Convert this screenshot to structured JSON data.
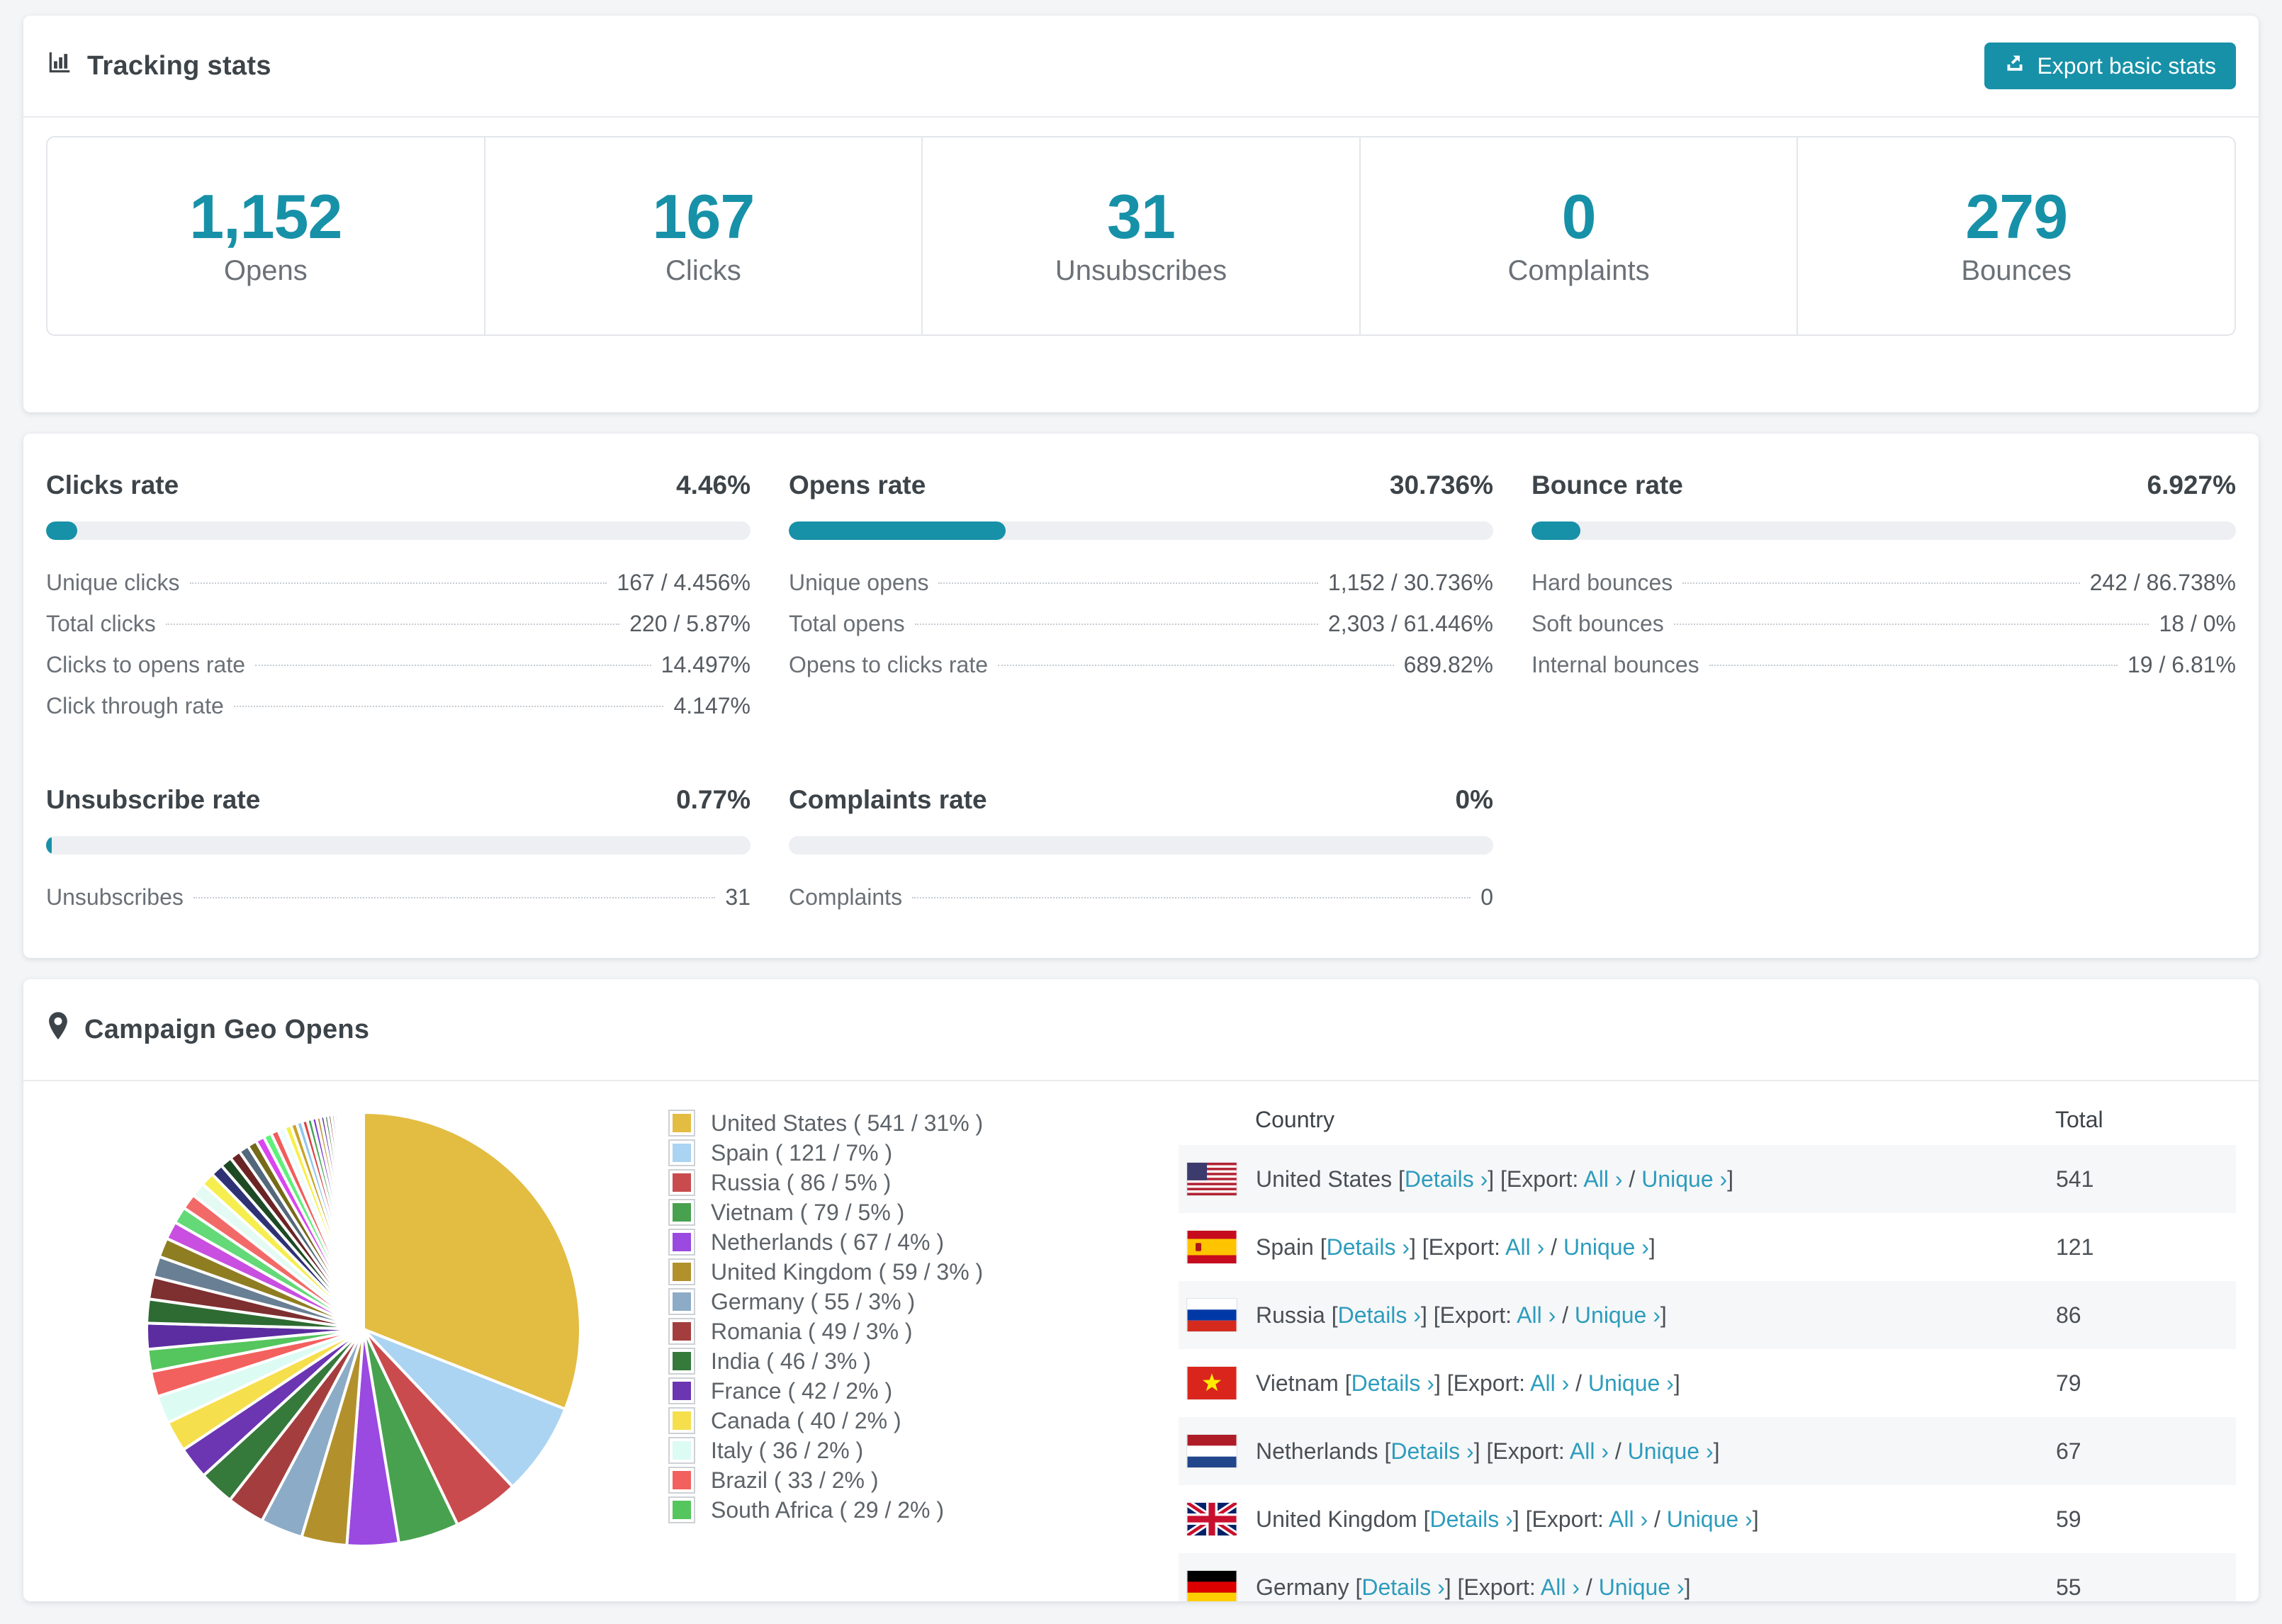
{
  "colors": {
    "accent": "#1791a8",
    "link": "#2d9cbd",
    "page_bg": "#f3f5f7"
  },
  "tracking": {
    "title": "Tracking stats",
    "export_label": "Export basic stats",
    "stats": [
      {
        "value": "1,152",
        "label": "Opens"
      },
      {
        "value": "167",
        "label": "Clicks"
      },
      {
        "value": "31",
        "label": "Unsubscribes"
      },
      {
        "value": "0",
        "label": "Complaints"
      },
      {
        "value": "279",
        "label": "Bounces"
      }
    ]
  },
  "rates": {
    "sections": [
      {
        "id": "clicks-rate",
        "title": "Clicks rate",
        "value": "4.46%",
        "percent": 4.46,
        "rows": [
          {
            "label": "Unique clicks",
            "value": "167 / 4.456%"
          },
          {
            "label": "Total clicks",
            "value": "220 / 5.87%"
          },
          {
            "label": "Clicks to opens rate",
            "value": "14.497%"
          },
          {
            "label": "Click through rate",
            "value": "4.147%"
          }
        ]
      },
      {
        "id": "opens-rate",
        "title": "Opens rate",
        "value": "30.736%",
        "percent": 30.736,
        "rows": [
          {
            "label": "Unique opens",
            "value": "1,152 / 30.736%"
          },
          {
            "label": "Total opens",
            "value": "2,303 / 61.446%"
          },
          {
            "label": "Opens to clicks rate",
            "value": "689.82%"
          }
        ]
      },
      {
        "id": "bounce-rate",
        "title": "Bounce rate",
        "value": "6.927%",
        "percent": 6.927,
        "rows": [
          {
            "label": "Hard bounces",
            "value": "242 / 86.738%"
          },
          {
            "label": "Soft bounces",
            "value": "18 / 0%"
          },
          {
            "label": "Internal bounces",
            "value": "19 / 6.81%"
          }
        ]
      },
      {
        "id": "unsubscribe-rate",
        "title": "Unsubscribe rate",
        "value": "0.77%",
        "percent": 0.77,
        "rows": [
          {
            "label": "Unsubscribes",
            "value": "31"
          }
        ]
      },
      {
        "id": "complaints-rate",
        "title": "Complaints rate",
        "value": "0%",
        "percent": 0,
        "rows": [
          {
            "label": "Complaints",
            "value": "0"
          }
        ]
      }
    ]
  },
  "geo": {
    "title": "Campaign Geo Opens",
    "table": {
      "headers": [
        "Country",
        "Total"
      ],
      "link_labels": {
        "details": "Details",
        "export": "Export:",
        "all": "All",
        "unique": "Unique",
        "arrow": "›"
      },
      "rows": [
        {
          "country": "United States",
          "flag": "us",
          "total": "541"
        },
        {
          "country": "Spain",
          "flag": "es",
          "total": "121"
        },
        {
          "country": "Russia",
          "flag": "ru",
          "total": "86"
        },
        {
          "country": "Vietnam",
          "flag": "vn",
          "total": "79"
        },
        {
          "country": "Netherlands",
          "flag": "nl",
          "total": "67"
        },
        {
          "country": "United Kingdom",
          "flag": "gb",
          "total": "59"
        },
        {
          "country": "Germany",
          "flag": "de",
          "total": "55"
        }
      ]
    },
    "chart_data": {
      "type": "pie",
      "title": "Campaign Geo Opens",
      "legend_position": "right",
      "slices": [
        {
          "name": "United States",
          "value": 541,
          "pct": 31,
          "color": "#e3bc42"
        },
        {
          "name": "Spain",
          "value": 121,
          "pct": 7,
          "color": "#abd3f2"
        },
        {
          "name": "Russia",
          "value": 86,
          "pct": 5,
          "color": "#c94b4d"
        },
        {
          "name": "Vietnam",
          "value": 79,
          "pct": 5,
          "color": "#48a14f"
        },
        {
          "name": "Netherlands",
          "value": 67,
          "pct": 4,
          "color": "#9a49e1"
        },
        {
          "name": "United Kingdom",
          "value": 59,
          "pct": 3,
          "color": "#b2912c"
        },
        {
          "name": "Germany",
          "value": 55,
          "pct": 3,
          "color": "#8cabc6"
        },
        {
          "name": "Romania",
          "value": 49,
          "pct": 3,
          "color": "#a43e3e"
        },
        {
          "name": "India",
          "value": 46,
          "pct": 3,
          "color": "#35793b"
        },
        {
          "name": "France",
          "value": 42,
          "pct": 2,
          "color": "#6c35b2"
        },
        {
          "name": "Canada",
          "value": 40,
          "pct": 2,
          "color": "#f6df4c"
        },
        {
          "name": "Italy",
          "value": 36,
          "pct": 2,
          "color": "#dcfbf3"
        },
        {
          "name": "Brazil",
          "value": 33,
          "pct": 2,
          "color": "#f2615e"
        },
        {
          "name": "South Africa",
          "value": 29,
          "pct": 2,
          "color": "#55c55e"
        }
      ],
      "unlabeled_slices": {
        "count": 46,
        "total_value": 462,
        "decay": 0.93,
        "palette": [
          "#5b2da0",
          "#2e6b32",
          "#7e2f2f",
          "#697f93",
          "#8f7d22",
          "#c94fe0",
          "#63d978",
          "#f26a68",
          "#e4fbf4",
          "#f5ee4e",
          "#2f3175",
          "#1d4a24",
          "#6b2424",
          "#53687a",
          "#756a18",
          "#d946ef",
          "#5ef07a",
          "#f25c5c",
          "#eefcff",
          "#f7ef4a",
          "#c9a227",
          "#8ec6f0",
          "#d94545",
          "#3fa44d",
          "#7a3fd1",
          "#b8952e"
        ]
      }
    }
  }
}
